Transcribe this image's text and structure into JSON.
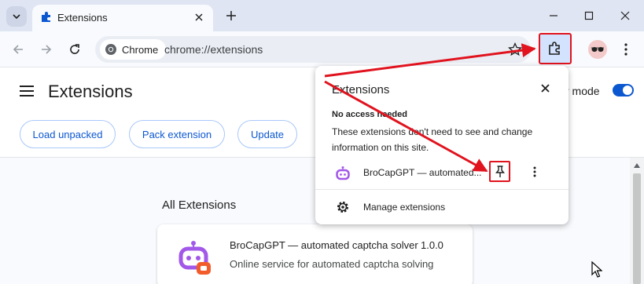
{
  "tab": {
    "title": "Extensions"
  },
  "toolbar": {
    "chip_label": "Chrome",
    "url": "chrome://extensions"
  },
  "page": {
    "title": "Extensions",
    "dev_mode_label": "r mode",
    "dev_mode_on": true,
    "buttons": [
      "Load unpacked",
      "Pack extension",
      "Update"
    ],
    "section_title": "All Extensions"
  },
  "card": {
    "name": "BroCapGPT — automated captcha solver",
    "version": "1.0.0",
    "description": "Online service for automated captcha solving"
  },
  "popup": {
    "title": "Extensions",
    "heading": "No access needed",
    "description": "These extensions don't need to see and change information on this site.",
    "ext_name": "BroCapGPT — automated...",
    "manage_label": "Manage extensions"
  },
  "colors": {
    "accent": "#0b57d0",
    "annotation": "#e0131e",
    "tabstrip": "#dfe5f2"
  }
}
